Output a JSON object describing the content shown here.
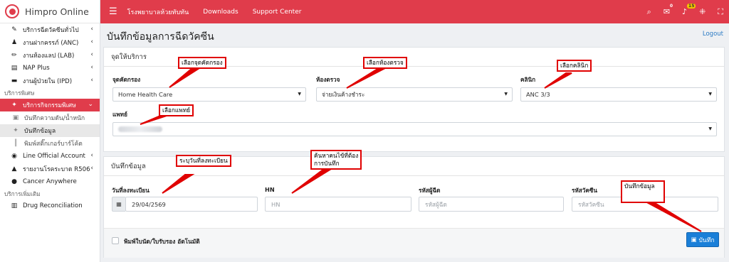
{
  "brand": {
    "name": "Himpro Online"
  },
  "sidebar": {
    "items": [
      {
        "label": "บริการฉีดวัคซีนทั่วไป",
        "icon": "syringe-icon",
        "chevron": "‹"
      },
      {
        "label": "งานฝากครรภ์ (ANC)",
        "icon": "pregnant-icon",
        "chevron": "‹"
      },
      {
        "label": "งานห้องแลป (LAB)",
        "icon": "pen-icon",
        "chevron": "‹"
      },
      {
        "label": "NAP Plus",
        "icon": "book-icon",
        "chevron": "‹"
      },
      {
        "label": "งานผู้ป่วยใน (IPD)",
        "icon": "bed-icon",
        "chevron": "‹"
      }
    ],
    "section1": "บริการพิเศษ",
    "active_item": {
      "label": "บริการกิจกรรมพิเศษ",
      "icon": "magic-wand-icon",
      "chevron": "⌄"
    },
    "sub_items": [
      {
        "label": "บันทึกความดัน/น้ำหนัก",
        "icon": "save-icon"
      },
      {
        "label": "บันทึกข้อมูล",
        "icon": "magic-wand-icon"
      },
      {
        "label": "พิมพ์สติ๊กเกอร์บาร์โค้ด",
        "icon": "barcode-icon"
      }
    ],
    "items2": [
      {
        "label": "Line Official Account",
        "icon": "line-icon",
        "chevron": "‹"
      },
      {
        "label": "รายงานโรคระบาด R506",
        "icon": "warning-icon",
        "chevron": "‹"
      },
      {
        "label": "Cancer Anywhere",
        "icon": "dot-icon",
        "chevron": ""
      }
    ],
    "section2": "บริการเพิ่มเติม",
    "items3": [
      {
        "label": "Drug Reconciliation",
        "icon": "file-icon",
        "chevron": ""
      }
    ]
  },
  "topbar": {
    "menu_glyph": "☰",
    "links": [
      "โรงพยาบาลห้วยทับทัน",
      "Downloads",
      "Support Center"
    ],
    "notif_badge": "15",
    "chat_badge": "0"
  },
  "page": {
    "title": "บันทึกข้อมูลการฉีดวัคซีน",
    "logout": "Logout"
  },
  "service_card": {
    "header": "จุดให้บริการ",
    "screen_point": {
      "label": "จุดคัดกรอง",
      "value": "Home Health Care"
    },
    "exam_room": {
      "label": "ห้องตรวจ",
      "value": "จ่ายเงินค้างชำระ"
    },
    "clinic": {
      "label": "คลินิก",
      "value": "ANC 3/3"
    },
    "doctor": {
      "label": "แพทย์"
    }
  },
  "record_card": {
    "header": "บันทึกข้อมูล",
    "reg_date": {
      "label": "วันที่ลงทะเบียน",
      "value": "29/04/2569"
    },
    "hn": {
      "label": "HN",
      "placeholder": "HN"
    },
    "injector_code": {
      "label": "รหัสผู้ฉีด",
      "placeholder": "รหัสผู้ฉีด"
    },
    "vaccine_code": {
      "label": "รหัสวัคซีน",
      "placeholder": "รหัสวัคซีน"
    },
    "auto_print_label": "พิมพ์ใบนัด/ใบรับรอง อัตโนมัติ",
    "save_label": "บันทึก"
  },
  "annotations": {
    "a1": "เลือกจุดคัดกรอง",
    "a2": "เลือกห้องตรวจ",
    "a3": "เลือกคลินิก",
    "a4": "เลือกแพทย์",
    "a5": "ระบุวันที่ลงทะเบียน",
    "a6_line1": "ค้นหาคนไข้ที่ต้อง",
    "a6_line2": "การบันทึก",
    "a7": "บันทึกข้อมูล"
  },
  "colors": {
    "brand_red": "#e03c4b",
    "save_blue": "#1a7fd8",
    "annotation_red": "#e00000"
  }
}
